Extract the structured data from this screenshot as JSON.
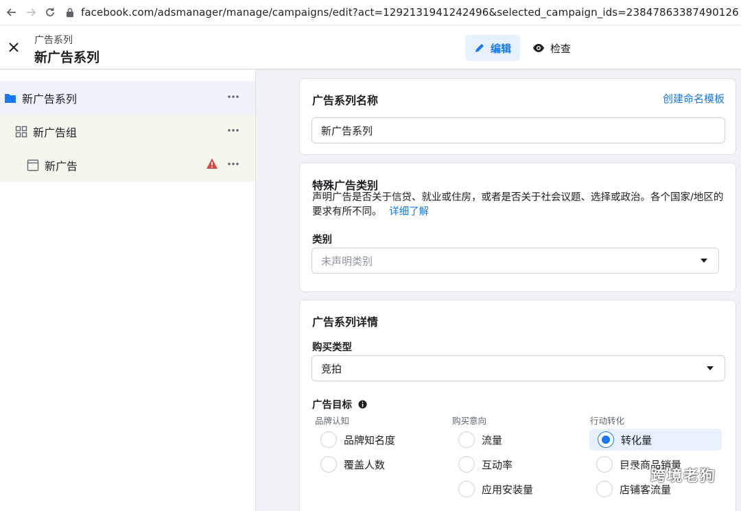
{
  "browser": {
    "url": "facebook.com/adsmanager/manage/campaigns/edit?act=1292131941242496&selected_campaign_ids=23847863387490126"
  },
  "header": {
    "subtitle": "广告系列",
    "title": "新广告系列",
    "edit_label": "编辑",
    "review_label": "检查"
  },
  "tree": {
    "campaign": "新广告系列",
    "adset": "新广告组",
    "ad": "新广告"
  },
  "name_card": {
    "title": "广告系列名称",
    "template_link": "创建命名模板",
    "value": "新广告系列"
  },
  "special_card": {
    "title": "特殊广告类别",
    "description": "声明广告是否关于信贷、就业或住房，或者是否关于社会议题、选择或政治。各个国家/地区的要求有所不同。",
    "learn_more": "详细了解",
    "category_label": "类别",
    "category_placeholder": "未声明类别"
  },
  "details_card": {
    "title": "广告系列详情",
    "buying_type_label": "购买类型",
    "buying_type_value": "竞拍",
    "objective_label": "广告目标",
    "groups": {
      "awareness": {
        "heading": "品牌认知",
        "options": [
          "品牌知名度",
          "覆盖人数"
        ]
      },
      "consideration": {
        "heading": "购买意向",
        "options": [
          "流量",
          "互动率",
          "应用安装量"
        ]
      },
      "conversion": {
        "heading": "行动转化",
        "options": [
          "转化量",
          "目录商品销量",
          "店铺客流量"
        ]
      }
    },
    "selected_objective": "转化量"
  },
  "watermark": "跨境老狗",
  "colors": {
    "accent": "#1877f2",
    "selected_bg": "#e7f0fd",
    "warning": "#e0423c"
  }
}
